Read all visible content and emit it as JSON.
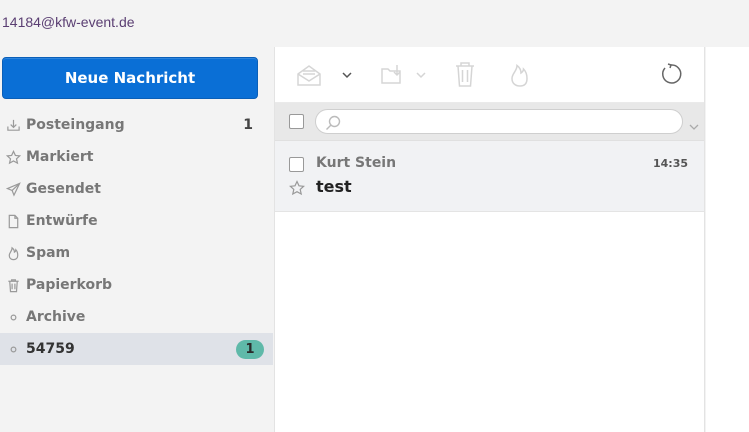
{
  "account": {
    "email": "14184@kfw-event.de"
  },
  "compose": {
    "label": "Neue Nachricht"
  },
  "folders": [
    {
      "label": "Posteingang",
      "icon": "inbox-icon",
      "count": "1"
    },
    {
      "label": "Markiert",
      "icon": "star-icon",
      "count": ""
    },
    {
      "label": "Gesendet",
      "icon": "send-icon",
      "count": ""
    },
    {
      "label": "Entwürfe",
      "icon": "draft-icon",
      "count": ""
    },
    {
      "label": "Spam",
      "icon": "flame-icon",
      "count": ""
    },
    {
      "label": "Papierkorb",
      "icon": "trash-icon",
      "count": ""
    },
    {
      "label": "Archive",
      "icon": "folder-dot-icon",
      "count": ""
    },
    {
      "label": "54759",
      "icon": "folder-dot-icon",
      "badge": "1",
      "active": true
    }
  ],
  "search": {
    "placeholder": "",
    "value": ""
  },
  "messages": [
    {
      "from": "Kurt Stein",
      "time": "14:35",
      "subject": "test"
    }
  ],
  "colors": {
    "accent": "#0a6fd6",
    "badge": "#5fb9a9",
    "account_text": "#5a3e72"
  }
}
